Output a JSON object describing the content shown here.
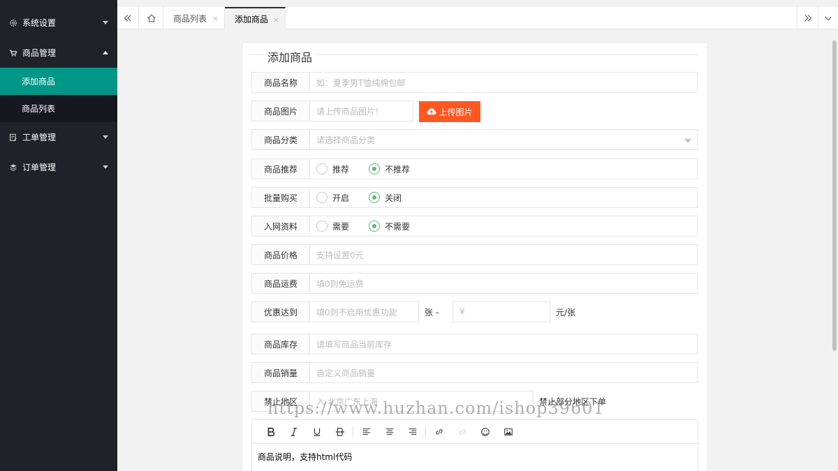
{
  "sidebar": {
    "items": [
      {
        "label": "系统设置",
        "icon": "gear-icon"
      },
      {
        "label": "商品管理",
        "icon": "cart-icon",
        "expanded": true,
        "children": [
          {
            "label": "添加商品",
            "active": true
          },
          {
            "label": "商品列表"
          }
        ]
      },
      {
        "label": "工单管理",
        "icon": "ticket-icon"
      },
      {
        "label": "订单管理",
        "icon": "layers-icon"
      }
    ]
  },
  "tabs": {
    "items": [
      {
        "label": "商品列表",
        "close": "×"
      },
      {
        "label": "添加商品",
        "close": "×",
        "active": true
      }
    ]
  },
  "form": {
    "title": "添加商品",
    "name": {
      "label": "商品名称",
      "placeholder": "如：夏季男T恤纯棉包邮"
    },
    "image": {
      "label": "商品图片",
      "placeholder": "请上传商品图片！",
      "button": "上传图片"
    },
    "category": {
      "label": "商品分类",
      "placeholder": "请选择商品分类"
    },
    "recommend": {
      "label": "商品推荐",
      "options": [
        "推荐",
        "不推荐"
      ],
      "selected": "不推荐"
    },
    "bulk": {
      "label": "批量购买",
      "options": [
        "开启",
        "关闭"
      ],
      "selected": "关闭"
    },
    "network": {
      "label": "入网资料",
      "options": [
        "需要",
        "不需要"
      ],
      "selected": "不需要"
    },
    "price": {
      "label": "商品价格",
      "placeholder": "支持设置0元"
    },
    "shipping": {
      "label": "商品运费",
      "placeholder": "填0则免运费"
    },
    "discount": {
      "label": "优惠达到",
      "placeholder": "填0则不启用优惠功能",
      "sep": "张 -",
      "yuan_placeholder": "¥",
      "unit": "元/张"
    },
    "stock": {
      "label": "商品库存",
      "placeholder": "请填写商品当前库存"
    },
    "sales": {
      "label": "商品销量",
      "placeholder": "自定义商品销量"
    },
    "region": {
      "label": "禁止地区",
      "placeholder": "入 北京广东上海",
      "hint": "禁止部分地区下单"
    },
    "editor": {
      "content": "商品说明，支持html代码"
    }
  },
  "watermark": "https://www.huzhan.com/ishop39601",
  "colors": {
    "sidebar_bg": "#20222a",
    "active_green": "#009688",
    "upload_orange": "#ff5722",
    "radio_green": "#5fb878"
  }
}
